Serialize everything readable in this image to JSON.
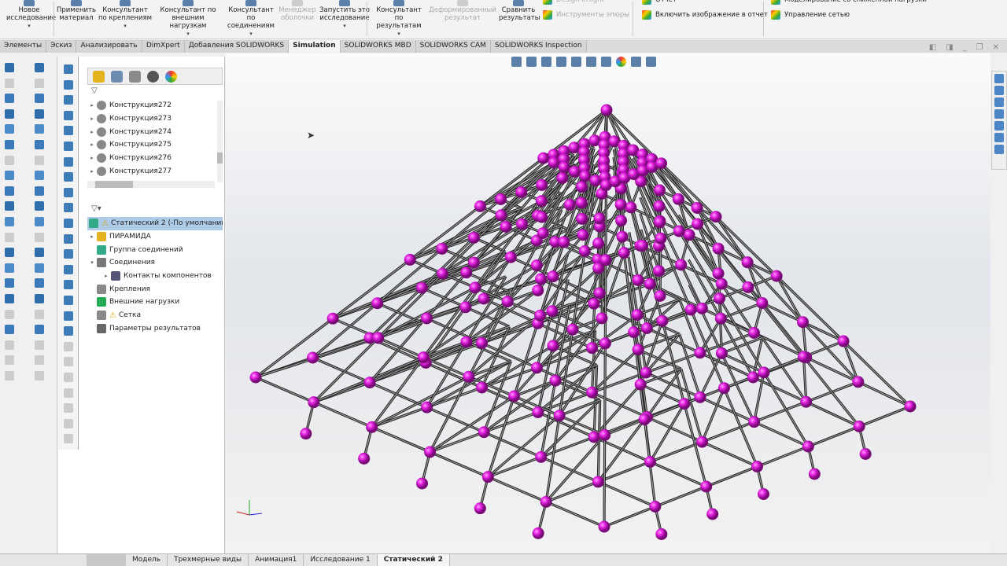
{
  "ribbon": {
    "buttons": [
      {
        "label": "Новое исследование",
        "dropdown": true,
        "enabled": true
      },
      {
        "label": "Применить материал",
        "dropdown": false,
        "enabled": true
      },
      {
        "label": "Консультант по креплениям",
        "dropdown": true,
        "enabled": true
      },
      {
        "label": "Консультант по внешним нагрузкам",
        "dropdown": true,
        "enabled": true
      },
      {
        "label": "Консультант по соединениям",
        "dropdown": true,
        "enabled": true
      },
      {
        "label": "Менеджер оболочки",
        "dropdown": false,
        "enabled": false
      },
      {
        "label": "Запустить это исследование",
        "dropdown": true,
        "enabled": true
      },
      {
        "label": "Консультант по результатам",
        "dropdown": true,
        "enabled": true
      },
      {
        "label": "Деформированный результат",
        "dropdown": false,
        "enabled": false
      },
      {
        "label": "Сравнить результаты",
        "dropdown": false,
        "enabled": true
      }
    ],
    "small": {
      "design_insight": "Design Insight",
      "plot_tools": "Инструменты эпюры",
      "report": "Отчет",
      "include_image": "Включить изображение в отчет",
      "reduced_load": "Моделирование со сниженной нагрузки",
      "network": "Управление сетью"
    }
  },
  "tabs": [
    "Элементы",
    "Эскиз",
    "Анализировать",
    "DimXpert",
    "Добавления SOLIDWORKS",
    "Simulation",
    "SOLIDWORKS MBD",
    "SOLIDWORKS CAM",
    "SOLIDWORKS Inspection"
  ],
  "active_tab": "Simulation",
  "feature_tree": {
    "items": [
      "Конструкция272",
      "Конструкция273",
      "Конструкция274",
      "Конструкция275",
      "Конструкция276",
      "Конструкция277"
    ]
  },
  "study_tree": {
    "study": "Статический 2 (-По умолчанию-)",
    "items": [
      {
        "label": "ПИРАМИДА",
        "level": 0,
        "expander": "▸",
        "warn": false
      },
      {
        "label": "Группа соединений",
        "level": 0,
        "expander": "",
        "warn": false
      },
      {
        "label": "Соединения",
        "level": 0,
        "expander": "▾",
        "warn": false
      },
      {
        "label": "Контакты компонентов",
        "level": 1,
        "expander": "▸",
        "warn": false
      },
      {
        "label": "Крепления",
        "level": 0,
        "expander": "",
        "warn": false
      },
      {
        "label": "Внешние нагрузки",
        "level": 0,
        "expander": "",
        "warn": false
      },
      {
        "label": "Сетка",
        "level": 0,
        "expander": "",
        "warn": true
      },
      {
        "label": "Параметры результатов",
        "level": 0,
        "expander": "",
        "warn": false
      }
    ]
  },
  "bottom_tabs": [
    "Модель",
    "Трехмерные виды",
    "Анимация1",
    "Исследование 1",
    "Статический 2"
  ],
  "active_bottom_tab": "Статический 2",
  "colors": {
    "node": "#e21ee0",
    "beam": "#3a3a3a",
    "accent": "#5a7fa8"
  }
}
